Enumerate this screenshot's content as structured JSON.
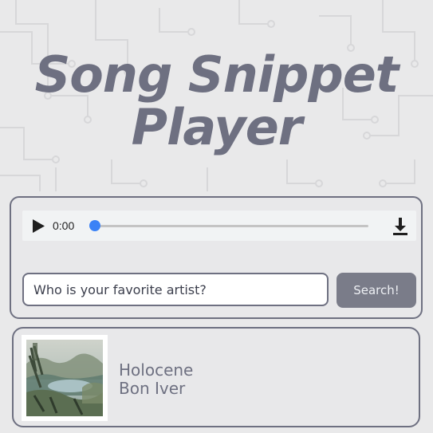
{
  "page": {
    "title_line1": "Song Snippet",
    "title_line2": "Player"
  },
  "player": {
    "current_time": "0:00",
    "progress": 0,
    "play_icon": "play-icon",
    "download_icon": "download-icon"
  },
  "search": {
    "placeholder": "Who is your favorite artist?",
    "value": "",
    "button_label": "Search!"
  },
  "results": [
    {
      "song": "Holocene",
      "artist": "Bon Iver",
      "image": "album-cover"
    }
  ],
  "colors": {
    "background": "#e9e9ea",
    "accent_slate": "#6e7081",
    "button_gray": "#7a7c89",
    "slider_blue": "#3b82f6"
  }
}
